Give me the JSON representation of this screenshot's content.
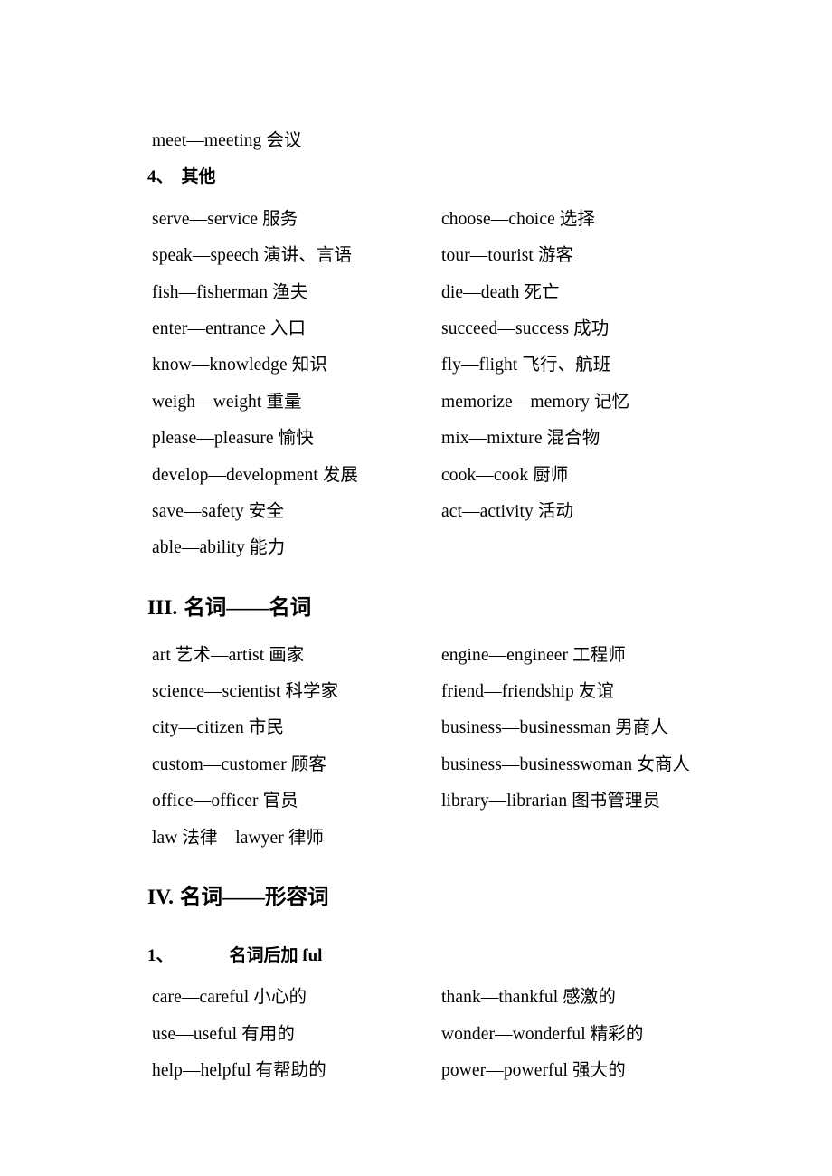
{
  "document": {
    "page_background": "#ffffff",
    "text_color": "#000000"
  },
  "blocks": {
    "orphan_line": {
      "text": "meet—meeting  会议"
    },
    "subsection_4": {
      "number": "4、",
      "title": "其他",
      "rows": [
        {
          "left": "serve—service  服务",
          "right": "choose—choice 选择"
        },
        {
          "left": "speak—speech  演讲、言语",
          "right": "tour—tourist  游客"
        },
        {
          "left": "fish—fisherman  渔夫",
          "right": "die—death  死亡"
        },
        {
          "left": "enter—entrance  入口",
          "right": "succeed—success  成功"
        },
        {
          "left": "know—knowledge  知识",
          "right": "fly—flight  飞行、航班"
        },
        {
          "left": "weigh—weight  重量",
          "right": "memorize—memory  记忆"
        },
        {
          "left": "please—pleasure  愉快",
          "right": "mix—mixture  混合物"
        },
        {
          "left": "develop—development  发展",
          "right": "cook—cook  厨师"
        },
        {
          "left": "save—safety  安全",
          "right": "act—activity  活动"
        },
        {
          "left": "able—ability  能力",
          "right": ""
        }
      ]
    },
    "section_3": {
      "numeral": "III.",
      "title": "名词——名词",
      "rows": [
        {
          "left": "art 艺术—artist 画家",
          "right": "engine—engineer 工程师"
        },
        {
          "left": "science—scientist  科学家",
          "right": "friend—friendship  友谊"
        },
        {
          "left": "city—citizen 市民",
          "right": "business—businessman 男商人"
        },
        {
          "left": "custom—customer  顾客",
          "right": "business—businesswoman  女商人"
        },
        {
          "left": "office—officer  官员",
          "right": "library—librarian  图书管理员"
        },
        {
          "left": "law 法律—lawyer 律师",
          "right": ""
        }
      ]
    },
    "section_4": {
      "numeral": "IV.",
      "title": "名词——形容词",
      "subsection_1": {
        "number": "1、",
        "title": "名词后加 ful",
        "rows": [
          {
            "left": "care—careful  小心的",
            "right": "thank—thankful  感激的"
          },
          {
            "left": "use—useful  有用的",
            "right": "wonder—wonderful 精彩的"
          },
          {
            "left": "help—helpful 有帮助的",
            "right": "power—powerful  强大的"
          }
        ]
      }
    }
  }
}
